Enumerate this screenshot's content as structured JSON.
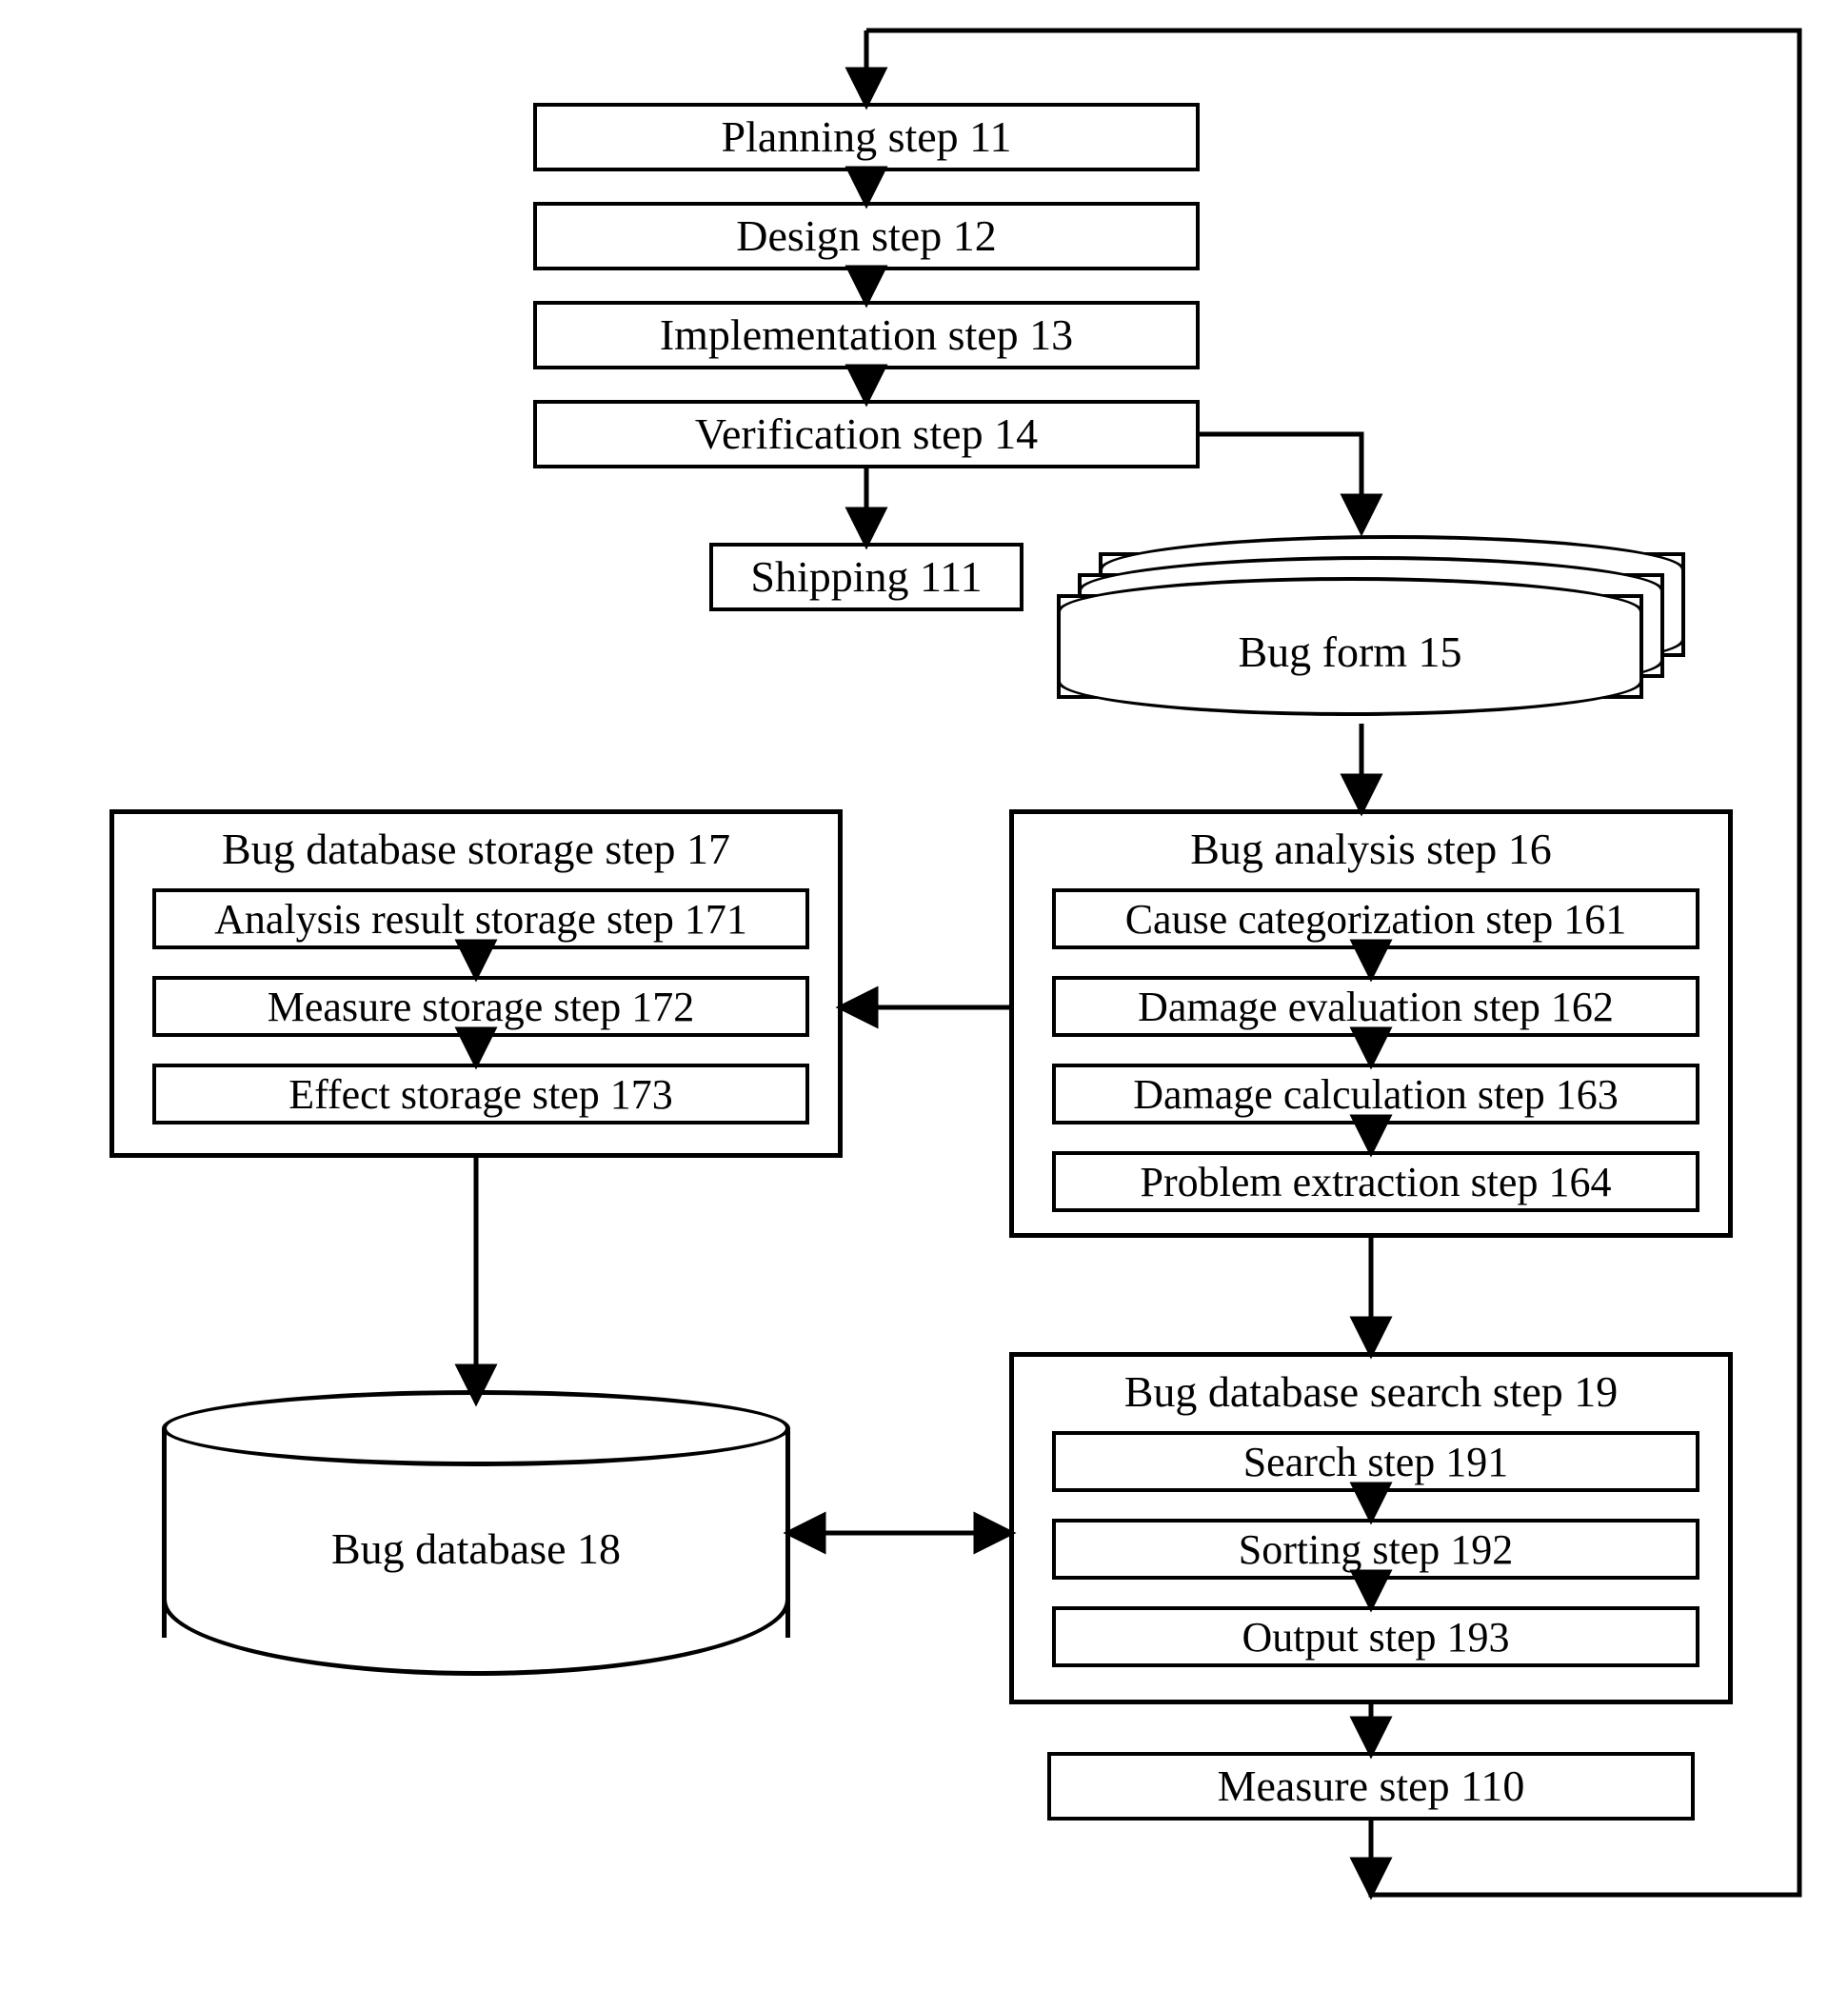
{
  "steps": {
    "planning": "Planning step 11",
    "design": "Design step 12",
    "implementation": "Implementation step 13",
    "verification": "Verification step 14",
    "shipping": "Shipping 111",
    "measure": "Measure step 110"
  },
  "bug_form": "Bug form 15",
  "bug_analysis": {
    "title": "Bug analysis step 16",
    "items": [
      "Cause categorization step 161",
      "Damage evaluation step 162",
      "Damage calculation step 163",
      "Problem extraction step 164"
    ]
  },
  "bug_storage": {
    "title": "Bug database storage step 17",
    "items": [
      "Analysis result storage step 171",
      "Measure storage step 172",
      "Effect storage step 173"
    ]
  },
  "bug_search": {
    "title": "Bug database search step 19",
    "items": [
      "Search step 191",
      "Sorting step 192",
      "Output step 193"
    ]
  },
  "database": "Bug database 18"
}
